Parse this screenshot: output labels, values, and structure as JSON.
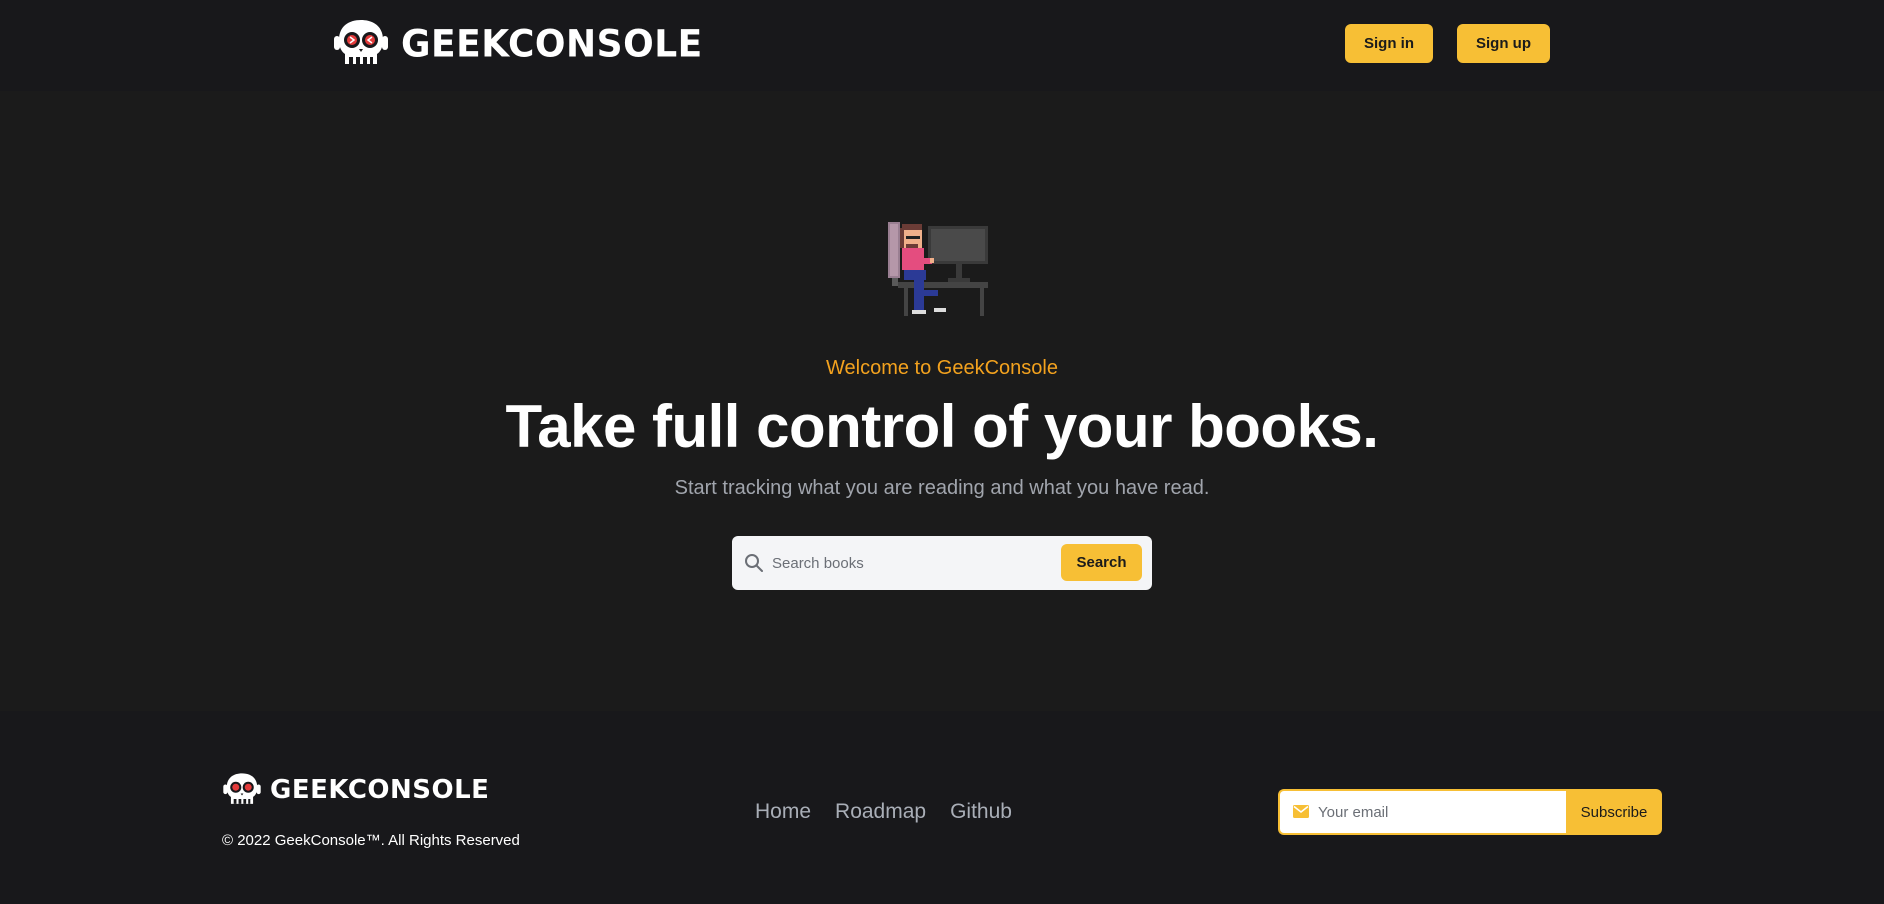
{
  "header": {
    "brand": "GEEKCONSOLE",
    "sign_in": "Sign in",
    "sign_up": "Sign up"
  },
  "hero": {
    "welcome": "Welcome to GeekConsole",
    "headline": "Take full control of your books.",
    "subtitle": "Start tracking what you are reading and what you have read.",
    "search_placeholder": "Search books",
    "search_button": "Search"
  },
  "footer": {
    "brand": "GEEKCONSOLE",
    "copyright": "© 2022 GeekConsole™. All Rights Reserved",
    "nav": [
      "Home",
      "Roadmap",
      "Github"
    ],
    "email_placeholder": "Your email",
    "subscribe": "Subscribe"
  },
  "colors": {
    "accent": "#f7bf35",
    "welcome": "#f3a21e",
    "background": "#1b1b1b",
    "header_footer": "#18181b"
  },
  "icons": [
    "skull-logo-icon",
    "search-icon",
    "mail-icon"
  ]
}
